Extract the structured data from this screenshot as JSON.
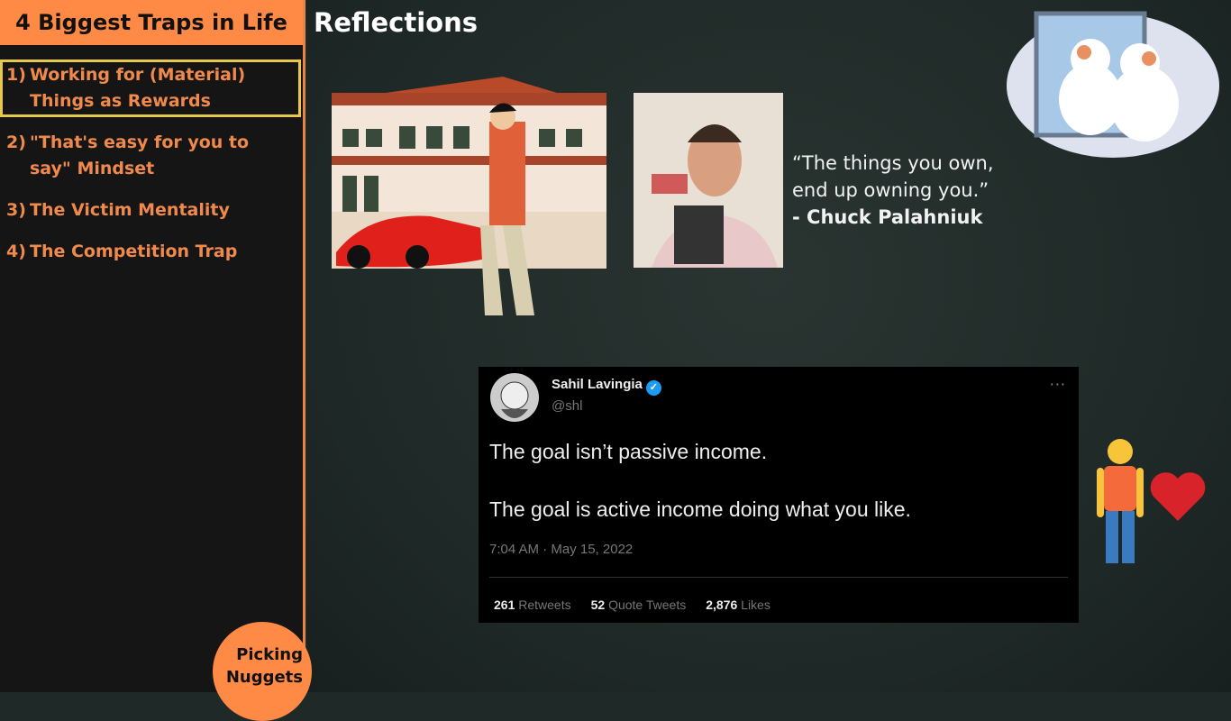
{
  "sidebar": {
    "title": "4 Biggest Traps in Life",
    "items": [
      {
        "num": "1)",
        "label": "Working for (Material) Things as Rewards",
        "active": true
      },
      {
        "num": "2)",
        "label": "\"That's easy for you to say\" Mindset"
      },
      {
        "num": "3)",
        "label": "The Victim Mentality"
      },
      {
        "num": "4)",
        "label": "The Competition Trap"
      }
    ],
    "logo_line1": "Picking",
    "logo_line2": "Nuggets"
  },
  "main": {
    "heading": "Reflections",
    "quote": {
      "line1": "“The things you own,",
      "line2": "end up owning you.”",
      "author": "- Chuck Palahniuk"
    }
  },
  "tweet": {
    "name": "Sahil Lavingia",
    "handle": "@shl",
    "line1": "The goal isn’t passive income.",
    "line2": "The goal is active income doing what you like.",
    "time": "7:04 AM · May 15, 2022",
    "stats": [
      {
        "count": "261",
        "label": "Retweets"
      },
      {
        "count": "52",
        "label": "Quote Tweets"
      },
      {
        "count": "2,876",
        "label": "Likes"
      }
    ]
  },
  "colors": {
    "accent": "#ff8a45",
    "highlight": "#e8c84a",
    "verified": "#1d9bf0"
  }
}
